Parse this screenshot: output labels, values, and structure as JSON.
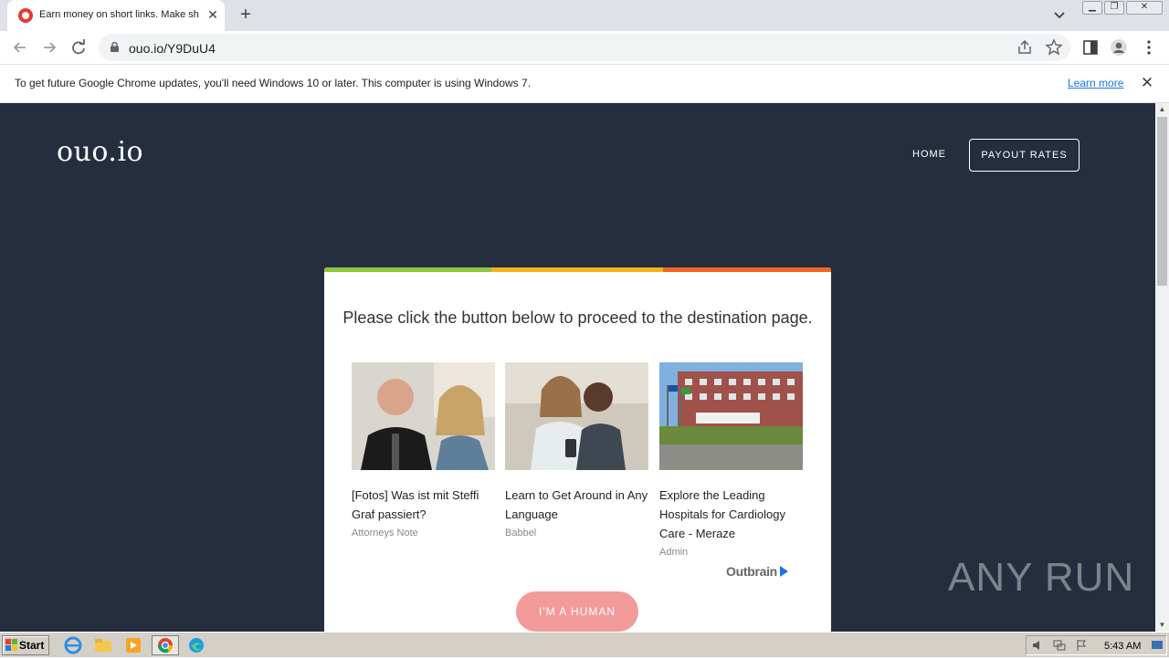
{
  "browser": {
    "tab_title": "Earn money on short links. Make sho",
    "url": "ouo.io/Y9DuU4",
    "infobar_text": "To get future Google Chrome updates, you'll need Windows 10 or later. This computer is using Windows 7.",
    "infobar_link": "Learn more"
  },
  "site": {
    "logo": "ouo.io",
    "nav": {
      "home": "HOME",
      "payout": "PAYOUT RATES"
    },
    "heading": "Please click the button below to proceed to the destination page.",
    "ads": [
      {
        "title": "[Fotos] Was ist mit Steffi Graf passiert?",
        "source": "Attorneys Note"
      },
      {
        "title": "Learn to Get Around in Any Language",
        "source": "Babbel"
      },
      {
        "title": "Explore the Leading Hospitals for Cardiology Care - Meraze",
        "source": "Admin"
      }
    ],
    "outbrain": "Outbrain",
    "human_button": "I'M A HUMAN",
    "stripe_colors": [
      "#8dc63f",
      "#f6b21b",
      "#f26522"
    ]
  },
  "watermark": "ANY RUN",
  "taskbar": {
    "start": "Start",
    "clock": "5:43 AM"
  }
}
